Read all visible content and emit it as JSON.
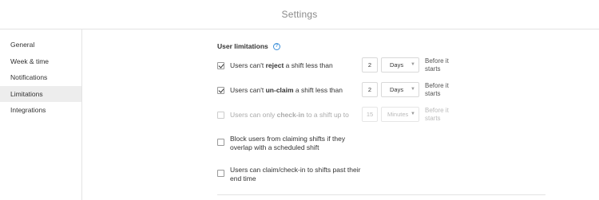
{
  "header": {
    "title": "Settings"
  },
  "sidebar": {
    "items": [
      {
        "label": "General"
      },
      {
        "label": "Week & time"
      },
      {
        "label": "Notifications"
      },
      {
        "label": "Limitations",
        "active": true
      },
      {
        "label": "Integrations"
      }
    ]
  },
  "main": {
    "section_title": "User limitations",
    "rows": [
      {
        "pre": "Users can't ",
        "bold": "reject",
        "post": " a shift less than",
        "checked": true,
        "disabled": false,
        "number": "2",
        "unit": "Days",
        "suffix": "Before it starts"
      },
      {
        "pre": "Users can't ",
        "bold": "un-claim",
        "post": " a shift less than",
        "checked": true,
        "disabled": false,
        "number": "2",
        "unit": "Days",
        "suffix": "Before it starts"
      },
      {
        "pre": "Users can only ",
        "bold": "check-in",
        "post": " to a shift up to",
        "checked": false,
        "disabled": true,
        "number": "15",
        "unit": "Minutes",
        "suffix": "Before it starts"
      },
      {
        "label": "Block users from claiming shifts if they overlap with a scheduled shift",
        "checked": false
      },
      {
        "label": "Users can claim/check-in to shifts past their end time",
        "checked": false
      }
    ]
  },
  "colors": {
    "accent": "#3b8fd9",
    "active_nav_bg": "#ededed",
    "border": "#e3e3e3"
  },
  "icons": {
    "help": "help-circle-icon",
    "checkmark": "check-icon",
    "dropdown": "caret-down-icon"
  }
}
